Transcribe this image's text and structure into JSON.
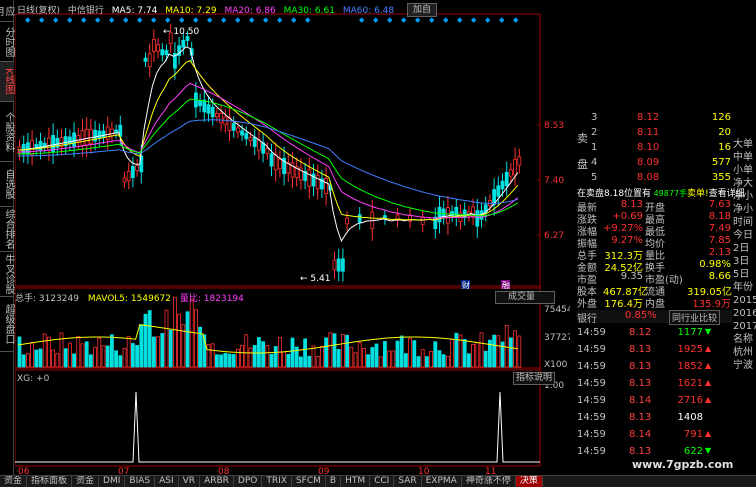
{
  "left_tabs": [
    "应用",
    "分时图",
    "K线图",
    "个股资料",
    "自选股",
    "综合排名",
    "牛叉诊股",
    "超级盘口"
  ],
  "active_tab_index": 2,
  "header": {
    "period": "日线(复权)",
    "stock": "中信银行",
    "ma5": "MA5: 7.74",
    "ma10": "MA10: 7.29",
    "ma20": "MA20: 6.86",
    "ma30": "MA30: 6.61",
    "ma60": "MA60: 6.48",
    "add_button": "加自"
  },
  "colors": {
    "up": "#ff3030",
    "down": "#00e0e0",
    "ma5": "#ffffff",
    "ma10": "#ffff00",
    "ma20": "#ff40ff",
    "ma30": "#00ff00",
    "ma60": "#4080ff",
    "label": "#c0c0c0"
  },
  "price_axis": [
    "8.53",
    "7.40",
    "6.27"
  ],
  "annotations": {
    "high": "10.50",
    "low": "5.41",
    "marker_cai": "财",
    "marker_rong": "融"
  },
  "volume": {
    "total": "总手: 3123249",
    "mavol5": "MAVOL5: 1549672",
    "ratio": "量比: 1823194",
    "selector": "成交量",
    "axis": [
      "75454",
      "37727",
      "X100"
    ]
  },
  "indicator": {
    "name": "XG: +0",
    "help": "指标说明",
    "axis": "1.00"
  },
  "x_axis": [
    "06",
    "07",
    "08",
    "09",
    "10",
    "11"
  ],
  "order_book": {
    "sell_label": "卖盘",
    "sell": [
      {
        "lvl": "3",
        "px": "8.12",
        "qty": "126"
      },
      {
        "lvl": "2",
        "px": "8.11",
        "qty": "20"
      },
      {
        "lvl": "1",
        "px": "8.10",
        "qty": "16"
      }
    ],
    "buy": [
      {
        "lvl": "4",
        "px": "8.09",
        "qty": "577"
      },
      {
        "lvl": "5",
        "px": "8.08",
        "qty": "355"
      }
    ],
    "notice_left": "在卖盘8.18位置有",
    "notice_qty": "49877手",
    "notice_tag": "卖单!",
    "notice_link": "查看详细"
  },
  "quote": [
    {
      "k1": "最新",
      "v1": "8.13",
      "k2": "开盘",
      "v2": "7.63"
    },
    {
      "k1": "涨跌",
      "v1": "+0.69",
      "k2": "最高",
      "v2": "8.18"
    },
    {
      "k1": "涨幅",
      "v1": "+9.27%",
      "k2": "最低",
      "v2": "7.49"
    },
    {
      "k1": "振幅",
      "v1": "9.27%",
      "k2": "均价",
      "v2": "7.85"
    },
    {
      "k1": "总手",
      "v1": "312.3万",
      "k2": "量比",
      "v2": "2.13"
    },
    {
      "k1": "金额",
      "v1": "24.52亿",
      "k2": "换手",
      "v2": "0.98%"
    },
    {
      "k1": "市盈",
      "v1": "9.35",
      "k2": "市盈(动)",
      "v2": "8.66"
    },
    {
      "k1": "股本",
      "v1": "467.87亿",
      "k2": "流通",
      "v2": "319.05亿"
    },
    {
      "k1": "外盘",
      "v1": "176.4万",
      "k2": "内盘",
      "v2": "135.9万"
    }
  ],
  "sector": {
    "name": "银行",
    "pct": "0.85%",
    "compare": "同行业比较"
  },
  "ticks": [
    {
      "t": "14:59",
      "p": "8.12",
      "v": "1177",
      "dir": "down"
    },
    {
      "t": "14:59",
      "p": "8.13",
      "v": "1925",
      "dir": "up"
    },
    {
      "t": "14:59",
      "p": "8.13",
      "v": "1852",
      "dir": "up"
    },
    {
      "t": "14:59",
      "p": "8.13",
      "v": "1621",
      "dir": "up"
    },
    {
      "t": "14:59",
      "p": "8.14",
      "v": "2716",
      "dir": "up"
    },
    {
      "t": "14:59",
      "p": "8.13",
      "v": "1408",
      "dir": "flat"
    },
    {
      "t": "14:59",
      "p": "8.14",
      "v": "791",
      "dir": "up"
    },
    {
      "t": "14:59",
      "p": "8.13",
      "v": "622",
      "dir": "down"
    }
  ],
  "right_edge": [
    "大单",
    "中单",
    "小单",
    "净大",
    "净小",
    "净小",
    "时间",
    "今日",
    "2日",
    "3日",
    "5日",
    "年份",
    "2015",
    "2016",
    "2017",
    "名称",
    "杭州",
    "宁波"
  ],
  "bottom_tabs": [
    "资金",
    "指标面板",
    "资金",
    "DMI",
    "BIAS",
    "ASI",
    "VR",
    "ARBR",
    "DPO",
    "TRIX",
    "SFCM",
    "B",
    "HTM",
    "CCI",
    "SAR",
    "EXPMA",
    "神奇涨不停",
    "决策"
  ],
  "watermark": "www.7gpzb.com"
}
